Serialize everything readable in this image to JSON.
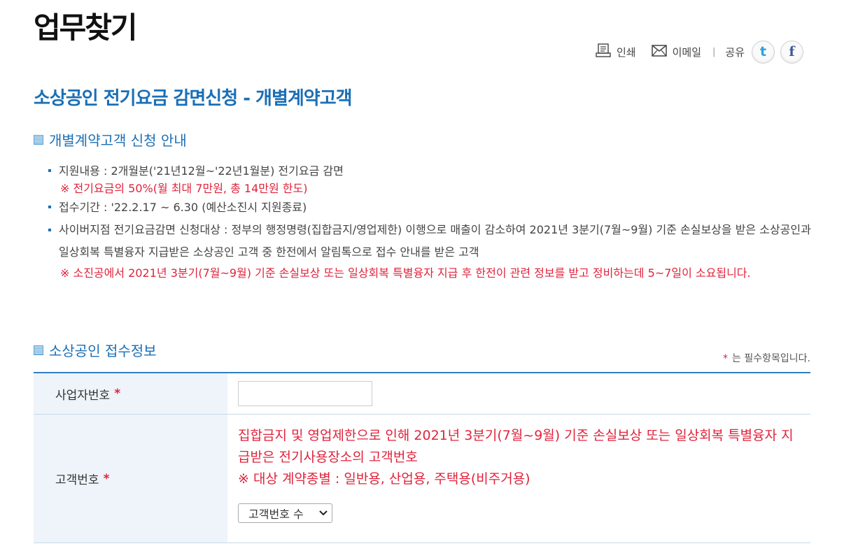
{
  "page": {
    "title": "업무찾기"
  },
  "utility": {
    "print_label": "인쇄",
    "email_label": "이메일",
    "separator": "|",
    "share_label": "공유",
    "twitter_glyph": "t",
    "facebook_glyph": "f"
  },
  "section": {
    "title": "소상공인 전기요금 감면신청 - 개별계약고객"
  },
  "guide": {
    "heading": "개별계약고객 신청 안내",
    "items": [
      {
        "text": "지원내용 : 2개월분('21년12월~'22년1월분) 전기요금 감면",
        "note": "※ 전기요금의 50%(월 최대 7만원, 총 14만원 한도)"
      },
      {
        "text": "접수기간 : '22.2.17 ~ 6.30 (예산소진시 지원종료)"
      },
      {
        "text": "사이버지점 전기요금감면 신청대상 : 정부의 행정명령(집합금지/영업제한) 이행으로 매출이 감소하여 2021년 3분기(7월~9월) 기준 손실보상을 받은 소상공인과 일상회복 특별융자 지급받은 소상공인 고객 중 한전에서 알림톡으로 접수 안내를 받은 고객",
        "note": "※ 소진공에서 2021년 3분기(7월~9월) 기준 손실보상 또는 일상회복 특별융자 지급 후 한전이 관련 정보를 받고 정비하는데 5~7일이 소요됩니다."
      }
    ]
  },
  "form": {
    "heading": "소상공인 접수정보",
    "required_star": "*",
    "required_note": "는 필수항목입니다.",
    "business_number": {
      "label": "사업자번호",
      "value": ""
    },
    "customer_number": {
      "label": "고객번호",
      "description": "집합금지 및 영업제한으로 인해 2021년 3분기(7월~9월) 기준 손실보상 또는 일상회복 특별융자 지급받은 전기사용장소의 고객번호",
      "note": "※ 대상 계약종별 : 일반용, 산업용, 주택용(비주거용)",
      "select_value": "고객번호 수"
    }
  },
  "colors": {
    "accent_blue": "#1b6fb5",
    "alert_red": "#e0233b",
    "table_header_bg": "#eef4fa",
    "table_border": "#2f7fc1"
  },
  "icons": [
    "printer-icon",
    "mail-icon",
    "twitter-icon",
    "facebook-icon",
    "chevron-down-icon"
  ]
}
